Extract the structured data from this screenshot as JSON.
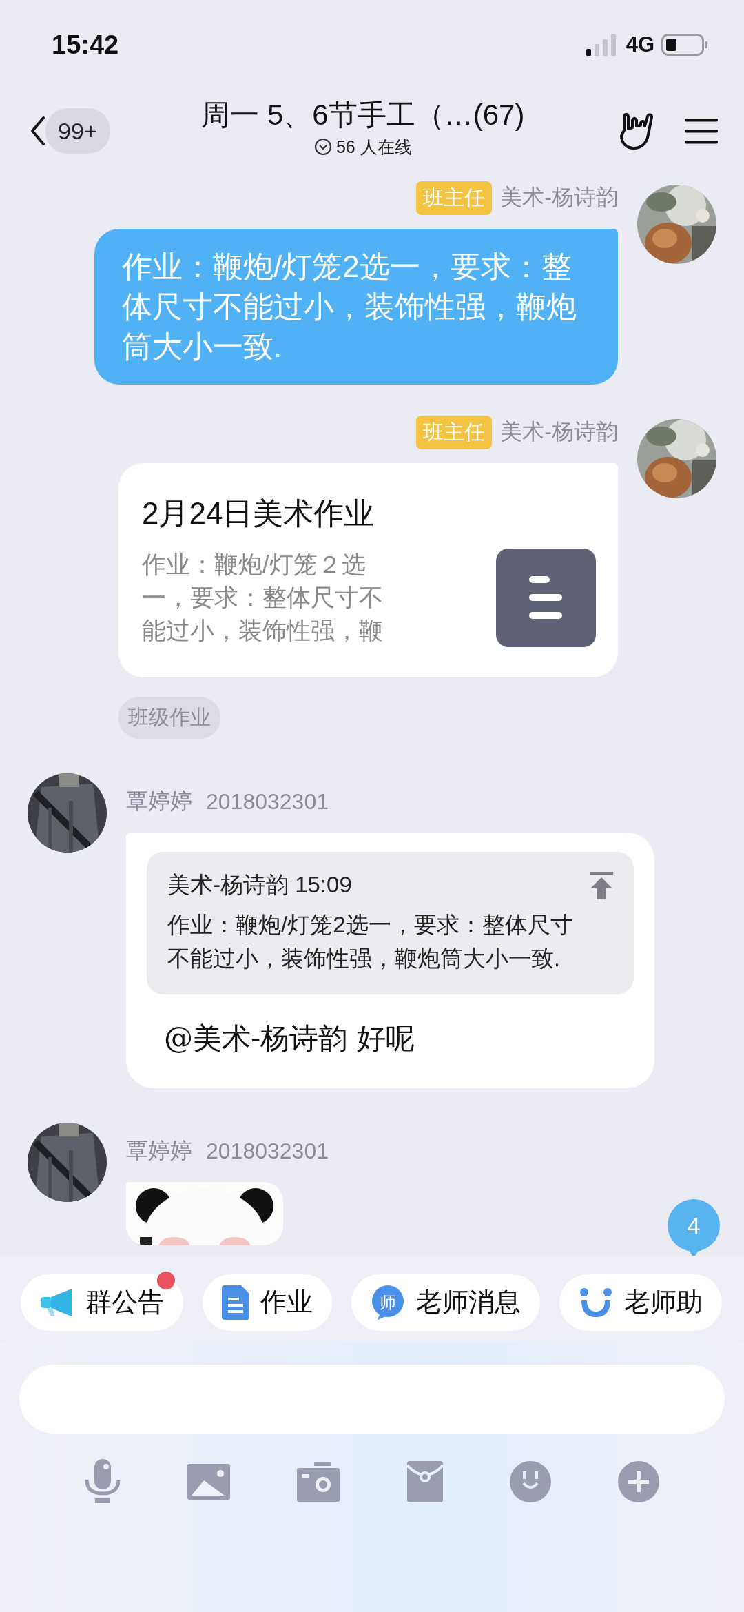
{
  "status_bar": {
    "time": "15:42",
    "network": "4G"
  },
  "header": {
    "unread_count": "99+",
    "title": "周一 5、6节手工（…(67)",
    "online": "56 人在线"
  },
  "messages": [
    {
      "kind": "text",
      "outgoing": true,
      "role_tag": "班主任",
      "sender": "美术-杨诗韵",
      "text": "作业：鞭炮/灯笼2选一，要求：整体尺寸不能过小，装饰性强，鞭炮筒大小一致."
    },
    {
      "kind": "card",
      "outgoing": true,
      "role_tag": "班主任",
      "sender": "美术-杨诗韵",
      "title": "2月24日美术作业",
      "summary": "作业：鞭炮/灯笼２选一，要求：整体尺寸不能过小，装饰性强，鞭",
      "label": "班级作业"
    },
    {
      "kind": "quote_reply",
      "outgoing": false,
      "sender": "覃婷婷",
      "sender_id": "2018032301",
      "quote_header": "美术-杨诗韵 15:09",
      "quote_text": "作业：鞭炮/灯笼2选一，要求：整体尺寸不能过小，装饰性强，鞭炮筒大小一致.",
      "reply": "@美术-杨诗韵 好呢"
    },
    {
      "kind": "sticker",
      "outgoing": false,
      "sender": "覃婷婷",
      "sender_id": "2018032301"
    }
  ],
  "unread_badge": "4",
  "shortcuts": [
    {
      "kind": "announcement",
      "label": "群公告",
      "dot": true
    },
    {
      "kind": "homework",
      "label": "作业",
      "dot": false
    },
    {
      "kind": "teacher_message",
      "label": "老师消息",
      "icon_text": "师",
      "dot": false
    },
    {
      "kind": "assistant",
      "label": "老师助",
      "dot": false
    }
  ]
}
